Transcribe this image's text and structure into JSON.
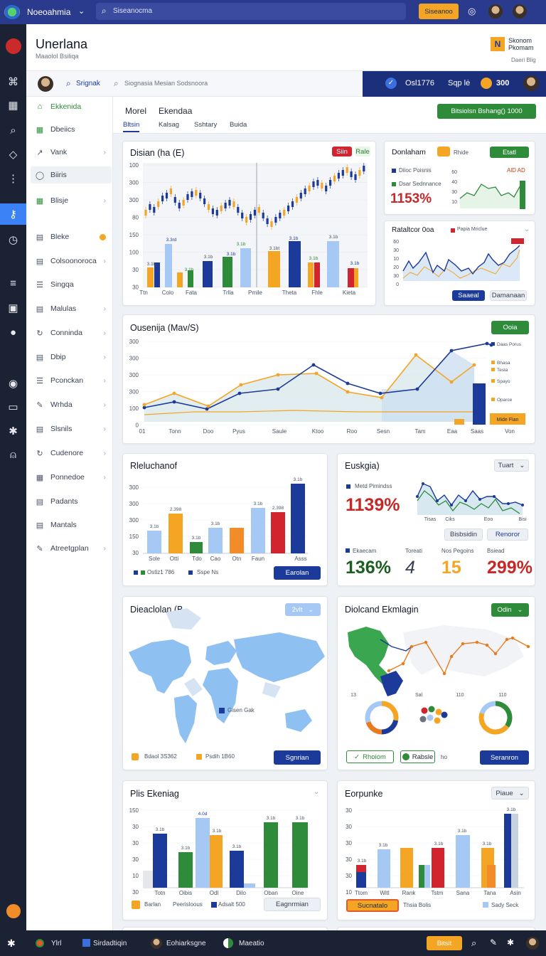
{
  "topbar": {
    "app_name": "Noeoahmia",
    "search_placeholder": "Siseanocma",
    "action_label": "Siseanoo"
  },
  "header": {
    "title": "Unerlana",
    "subtitle": "Maaolol Bsiliqa",
    "brand_line1": "Skonom",
    "brand_line2": "Pkomam",
    "brand_sub": "Daeri Blig"
  },
  "subbar": {
    "tab_label": "Srignak",
    "search_placeholder": "Siognasia Mesian Sodsnoora",
    "status_text": "Osl1776",
    "status_right": "Sqp lė",
    "status_count": "300"
  },
  "sidebar": {
    "items": [
      {
        "label": "Ekkenida",
        "icon": "home-icon"
      },
      {
        "label": "Dbeiics",
        "icon": "grid-icon"
      },
      {
        "label": "Vank",
        "icon": "chart-icon"
      },
      {
        "label": "Biiris",
        "icon": "circle-icon"
      },
      {
        "label": "Blisje",
        "icon": "grid-icon"
      },
      {
        "label": "Bleke",
        "icon": "document-icon"
      },
      {
        "label": "Colsoonoroca",
        "icon": "document-icon"
      },
      {
        "label": "Singqa",
        "icon": "list-icon"
      },
      {
        "label": "Malulas",
        "icon": "document-icon"
      },
      {
        "label": "Conninda",
        "icon": "refresh-icon"
      },
      {
        "label": "Dbip",
        "icon": "document-icon"
      },
      {
        "label": "Pconckan",
        "icon": "list-icon"
      },
      {
        "label": "Wrhda",
        "icon": "edit-icon"
      },
      {
        "label": "Slsnils",
        "icon": "document-icon"
      },
      {
        "label": "Cudenore",
        "icon": "refresh-icon"
      },
      {
        "label": "Ponnedoe",
        "icon": "grid-icon"
      },
      {
        "label": "Padants",
        "icon": "document-icon"
      },
      {
        "label": "Mantals",
        "icon": "document-icon"
      },
      {
        "label": "Atreetgplan",
        "icon": "edit-icon"
      }
    ]
  },
  "page": {
    "breadcrumb1": "Morel",
    "breadcrumb2": "Ekendaa",
    "action": "Bitsiolsn Bshang() 1000",
    "tabs": [
      "Bltsin",
      "Kalsag",
      "Sshtary",
      "Buida"
    ]
  },
  "card1": {
    "title": "Disian (ha (E)",
    "btn1": "Siin",
    "btn2": "Rale",
    "chart_data": {
      "type": "bar",
      "y_ticks": [
        "100",
        "300",
        "300",
        "80",
        "150",
        "100",
        "30",
        "30"
      ],
      "categories": [
        "Ttn",
        "Colo",
        "Fata",
        "Trlla",
        "Pmile",
        "",
        "Theta",
        "Fhle",
        "Kieta"
      ],
      "bar_labels": [
        "3.1b",
        "3.3rd",
        "3.1b",
        "3.1b",
        "3.1b",
        "3.1b",
        "3.1bt",
        "3.1b",
        "3.1b",
        "3.1b"
      ]
    }
  },
  "card2": {
    "title": "Donlaham",
    "btn1": "Rhide",
    "btn2": "Etatl",
    "legend1": "Diioc Poisnis",
    "legend2": "Dsar Sednnance",
    "value": "1153%",
    "extra": "AlD AD"
  },
  "card3": {
    "title": "Rataltcor 0oa",
    "legend": "Papia Mriclue",
    "btn1": "Saaeal",
    "btn2": "Damanaan"
  },
  "card4": {
    "title": "Ousenija (Mav/S)",
    "btn": "Ooia",
    "legend": [
      "Daas Porus",
      "Tesla",
      "Bhasa",
      "Spayo",
      "Oparce"
    ],
    "note": "Mide Fian",
    "chart_data": {
      "type": "line",
      "y_ticks": [
        "300",
        "300",
        "300",
        "300",
        "100",
        "0"
      ],
      "categories": [
        "01",
        "Tonn",
        "Doo",
        "Pyus",
        "Saule",
        "Ktoo",
        "Roo",
        "Sesn",
        "Tam",
        "Eaa",
        "Saas",
        "Von"
      ]
    }
  },
  "card5": {
    "title": "Rleluchanof",
    "legend1": "Ostiz1 786",
    "legend2": "Sspe Ns",
    "btn": "Earolan",
    "chart_data": {
      "type": "bar",
      "y_ticks": [
        "300",
        "300",
        "300",
        "150",
        "30"
      ],
      "categories": [
        "Sole",
        "Otti",
        "Tdo",
        "Cao",
        "Otn",
        "Faun",
        "Asss"
      ],
      "bar_labels": [
        "3.1b",
        "2.398",
        "3.1b",
        "3.1b",
        "3.1b",
        "2.398",
        "3.1b"
      ]
    }
  },
  "card6": {
    "title": "Euskgia)",
    "dropdown": "Tuart",
    "sub": "Metd Pimindss",
    "value": "1139%",
    "chart_data": {
      "type": "line",
      "categories": [
        "Tisas",
        "Ciks",
        "Eoo",
        "Bisi"
      ]
    },
    "btn1": "Bisbsidin",
    "btn2": "Renoror",
    "stats": [
      {
        "label": "Ekaecam",
        "value": "136%"
      },
      {
        "label": "Toreati",
        "value": "4"
      },
      {
        "label": "Nos Pegoins",
        "value": "15"
      },
      {
        "label": "Bsiead",
        "value": "299%"
      }
    ]
  },
  "card7": {
    "title": "Dieaclolan (B",
    "btn": "2vlt",
    "map_label": "Gisen Gak",
    "legend1": "Bdaol 3S362",
    "legend2": "Psdih 1B60",
    "btn2": "Sgnrian"
  },
  "card8": {
    "title": "Diolcand Ekmlagin",
    "btn": "Odin",
    "labels": [
      "13",
      "Sal",
      "110",
      "110"
    ],
    "btn1": "Rhoiom",
    "btn2": "Rabsle",
    "pill": "ho",
    "btn3": "Seranron"
  },
  "card9": {
    "title": "Plis Ekeniag",
    "legend1": "Barlan",
    "legend2": "Peerisloous",
    "legend3": "Adsalt 500",
    "btn": "Eagnrmian",
    "chart_data": {
      "type": "bar",
      "y_ticks": [
        "150",
        "30",
        "30",
        "30",
        "10",
        "30"
      ],
      "categories": [
        "Totn",
        "Oibis",
        "Odl",
        "Dilo",
        "Oban",
        "Oine"
      ],
      "bar_labels": [
        "3.1b",
        "3.1b",
        "4.0d",
        "3.1b",
        "3.1b",
        "3.1b",
        "3.1b"
      ]
    }
  },
  "card10": {
    "title": "Eorpunke",
    "dropdown": "Piaue",
    "legend1": "Sucnatalo",
    "legend2": "Thsia Bolis",
    "legend3": "Sady Seck",
    "chart_data": {
      "type": "bar",
      "y_ticks": [
        "30",
        "30",
        "30",
        "30",
        "30",
        "10"
      ],
      "categories": [
        "Ttom",
        "Witl",
        "Rank",
        "Tstm",
        "Sana",
        "Tana",
        "Asin"
      ],
      "bar_labels": [
        "3.1b",
        "3.1b",
        "3.1b",
        "3.1b",
        "3.1b",
        "3.1b"
      ]
    }
  },
  "taskbar": {
    "items": [
      "Ylrl",
      "Sirdadtiqin",
      "Eohiarksgne",
      "Maeatio"
    ],
    "action": "Bitsit"
  }
}
